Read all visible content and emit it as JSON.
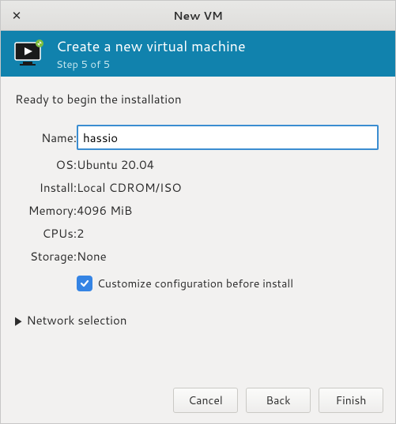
{
  "window": {
    "title": "New VM"
  },
  "header": {
    "heading": "Create a new virtual machine",
    "step": "Step 5 of 5"
  },
  "ready_text": "Ready to begin the installation",
  "labels": {
    "name": "Name:",
    "os": "OS:",
    "install": "Install:",
    "memory": "Memory:",
    "cpus": "CPUs:",
    "storage": "Storage:"
  },
  "values": {
    "name": "hassio",
    "os": "Ubuntu 20.04",
    "install": "Local CDROM/ISO",
    "memory": "4096 MiB",
    "cpus": "2",
    "storage": "None"
  },
  "checkbox": {
    "customize": "Customize configuration before install",
    "checked": true
  },
  "disclosure": {
    "network": "Network selection"
  },
  "buttons": {
    "cancel": "Cancel",
    "back": "Back",
    "finish": "Finish"
  }
}
